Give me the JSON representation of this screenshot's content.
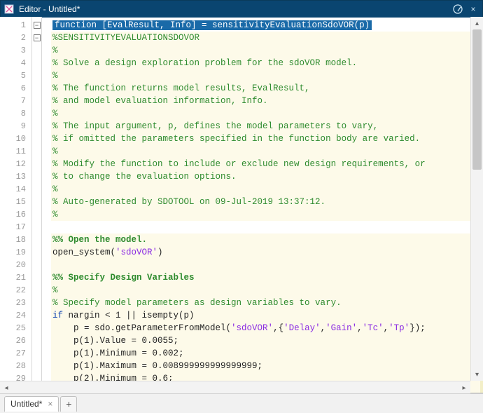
{
  "window": {
    "title": "Editor - Untitled*"
  },
  "titlebar_buttons": {
    "help": "?",
    "maximize": "⊙",
    "close": "×"
  },
  "foldmarks": {
    "line1": "−",
    "line2": "−"
  },
  "gutter": [
    "1",
    "2",
    "3",
    "4",
    "5",
    "6",
    "7",
    "8",
    "9",
    "10",
    "11",
    "12",
    "13",
    "14",
    "15",
    "16",
    "17",
    "18",
    "19",
    "20",
    "21",
    "22",
    "23",
    "24",
    "25",
    "26",
    "27",
    "28",
    "29"
  ],
  "code": {
    "l1_head": "function [EvalResult, Info] = sensitivityEvaluationSdoVOR(p)",
    "l2": "%SENSITIVITYEVALUATIONSDOVOR",
    "l3": "%",
    "l4": "% Solve a design exploration problem for the sdoVOR model.",
    "l5": "%",
    "l6": "% The function returns model results, EvalResult,",
    "l7": "% and model evaluation information, Info.",
    "l8": "%",
    "l9": "% The input argument, p, defines the model parameters to vary,",
    "l10": "% if omitted the parameters specified in the function body are varied.",
    "l11": "%",
    "l12": "% Modify the function to include or exclude new design requirements, or",
    "l13": "% to change the evaluation options.",
    "l14": "%",
    "l15": "% Auto-generated by SDOTOOL on 09-Jul-2019 13:37:12.",
    "l16": "%",
    "l17": "",
    "l18": "%% Open the model.",
    "l19a": "open_system(",
    "l19b": "'sdoVOR'",
    "l19c": ")",
    "l20": "",
    "l21": "%% Specify Design Variables",
    "l22": "%",
    "l23": "% Specify model parameters as design variables to vary.",
    "l24a": "if",
    "l24b": " nargin < 1 || isempty(p)",
    "l25a": "    p = sdo.getParameterFromModel(",
    "l25b": "'sdoVOR'",
    "l25c": ",{",
    "l25d": "'Delay'",
    "l25e": ",",
    "l25f": "'Gain'",
    "l25g": ",",
    "l25h": "'Tc'",
    "l25i": ",",
    "l25j": "'Tp'",
    "l25k": "});",
    "l26": "    p(1).Value = 0.0055;",
    "l27": "    p(1).Minimum = 0.002;",
    "l28": "    p(1).Maximum = 0.008999999999999999;",
    "l29": "    p(2).Minimum = 0.6;"
  },
  "tab": {
    "name": "Untitled*",
    "close": "×",
    "add": "+"
  },
  "scroll": {
    "up": "▴",
    "down": "▾",
    "left": "◂",
    "right": "▸"
  }
}
